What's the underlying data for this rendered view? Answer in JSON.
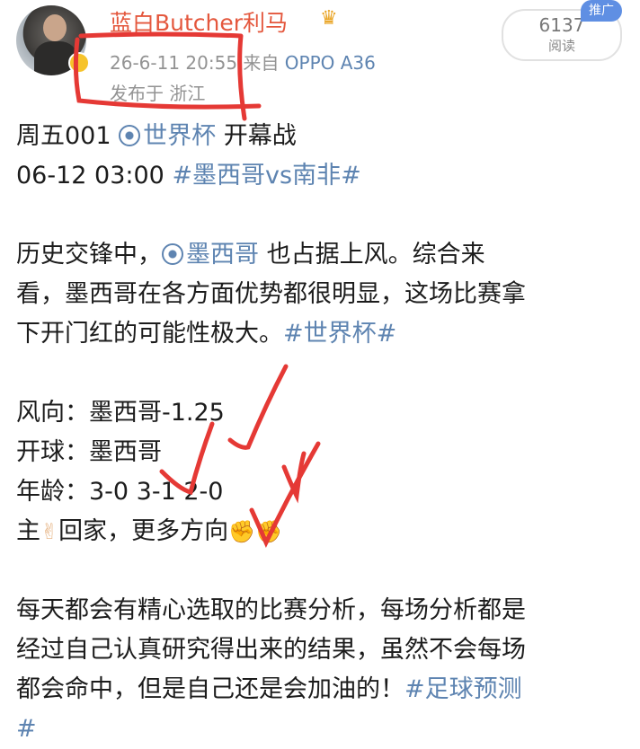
{
  "post": {
    "username": "蓝白Butcher利马",
    "timestamp": "26-6-11 20:55",
    "source_prefix": "来自",
    "device": "OPPO A36",
    "location": "发布于 浙江",
    "read_count": "6137",
    "read_label": "阅读",
    "promo_badge": "推广"
  },
  "icons": {
    "crown": "crown-icon",
    "verified": "verified-badge-icon",
    "football": "football-icon",
    "victory_hand": "victory-hand-emoji",
    "flexed_biceps": "flexed-biceps-emoji"
  },
  "colors": {
    "username": "#e4573d",
    "link": "#5e84b1",
    "annotation": "#e53935",
    "promo_badge": "#5f8fe3"
  },
  "body": {
    "line1_a": "周五001 ",
    "line1_tag": "世界杯",
    "line1_b": " 开幕战",
    "line2_a": "06-12 03:00 ",
    "line2_tag": "#墨西哥vs南非#",
    "para2_a": "历史交锋中，",
    "para2_tag": "墨西哥",
    "para2_b": " 也占据上风。综合来",
    "para2_line2": "看，墨西哥在各方面优势都很明显，这场比赛拿",
    "para2_line3_a": "下开门红的可能性极大。",
    "para2_line3_tag": "#世界杯#",
    "wind": "风向：墨西哥-1.25",
    "kickoff": "开球：墨西哥",
    "age": "年龄：3-0 3-1 2-0",
    "home_a": "主",
    "home_b": "回家，更多方向",
    "para4_line1": "每天都会有精心选取的比赛分析，每场分析都是",
    "para4_line2": "经过自己认真研究得出来的结果，虽然不会每场",
    "para4_line3_a": "都会命中，但是自己还是会加油的！",
    "para4_line3_tag": "#足球预测",
    "para4_line4": "#"
  }
}
